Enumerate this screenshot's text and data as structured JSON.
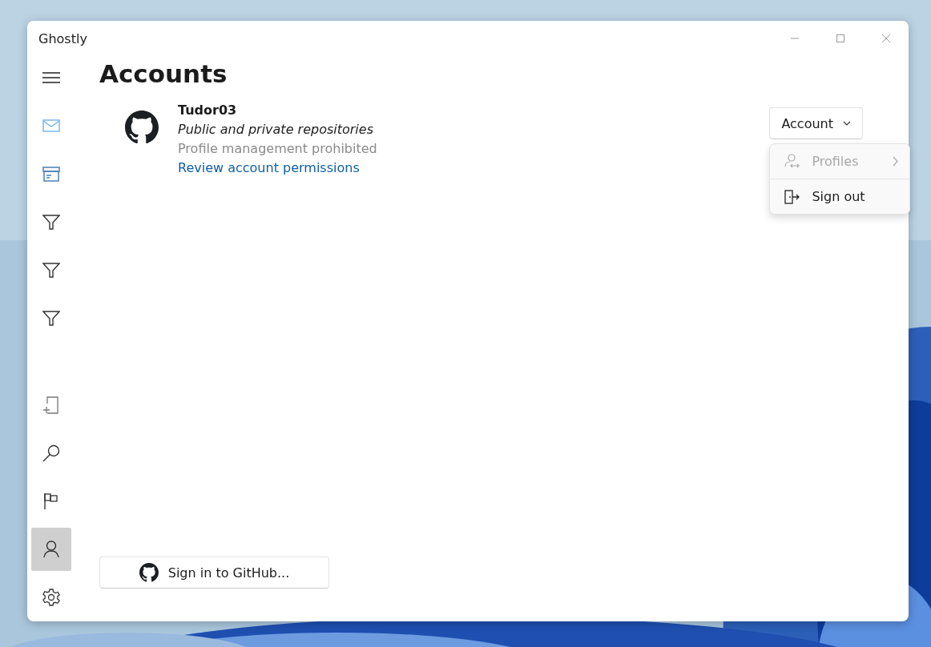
{
  "window": {
    "title": "Ghostly"
  },
  "nav": {
    "top": [
      {
        "kind": "menu",
        "selected": false
      },
      {
        "kind": "mail",
        "selected": false
      },
      {
        "kind": "archive",
        "selected": false
      },
      {
        "kind": "filter",
        "selected": false
      },
      {
        "kind": "filter",
        "selected": false
      },
      {
        "kind": "filter",
        "selected": false
      }
    ],
    "bottom": [
      {
        "kind": "new",
        "selected": false
      },
      {
        "kind": "search",
        "selected": false
      },
      {
        "kind": "flag",
        "selected": false
      },
      {
        "kind": "person",
        "selected": true
      },
      {
        "kind": "settings",
        "selected": false
      }
    ]
  },
  "page": {
    "title": "Accounts"
  },
  "account": {
    "name": "Tudor03",
    "scope": "Public and private repositories",
    "note": "Profile management prohibited",
    "link": "Review account permissions"
  },
  "account_button": {
    "label": "Account",
    "expanded": true
  },
  "menu": [
    {
      "kind": "profiles",
      "label": "Profiles",
      "disabled": true,
      "submenu": true
    },
    {
      "kind": "sign_out",
      "label": "Sign out",
      "disabled": false,
      "submenu": false
    }
  ],
  "sign_in_button": {
    "label": "Sign in to GitHub..."
  }
}
